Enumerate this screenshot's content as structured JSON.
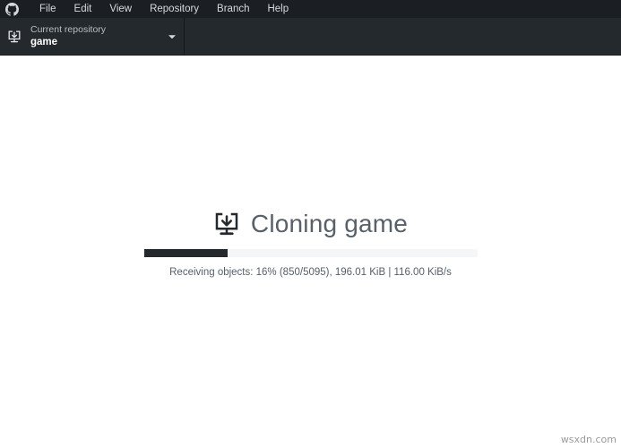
{
  "menubar": {
    "logo_icon": "github-octocat-icon",
    "items": [
      {
        "label": "File"
      },
      {
        "label": "Edit"
      },
      {
        "label": "View"
      },
      {
        "label": "Repository"
      },
      {
        "label": "Branch"
      },
      {
        "label": "Help"
      }
    ]
  },
  "toolbar": {
    "repository": {
      "icon": "repo-clone-icon",
      "label": "Current repository",
      "name": "game",
      "chevron_icon": "chevron-down-icon"
    }
  },
  "main": {
    "clone_icon": "download-into-tray-icon",
    "title": "Cloning game",
    "progress": {
      "percent": 16,
      "fill_width_percent": 25,
      "status": "Receiving objects: 16% (850/5095), 196.01 KiB | 116.00 KiB/s"
    }
  },
  "watermark": {
    "text": "wsxdn.com"
  },
  "colors": {
    "menubar_bg": "#1b1f23",
    "toolbar_bg": "#24292e",
    "content_bg": "#ffffff",
    "progress_fill": "#24292e",
    "progress_track": "#f4f6f8",
    "title_text": "#58606a"
  }
}
